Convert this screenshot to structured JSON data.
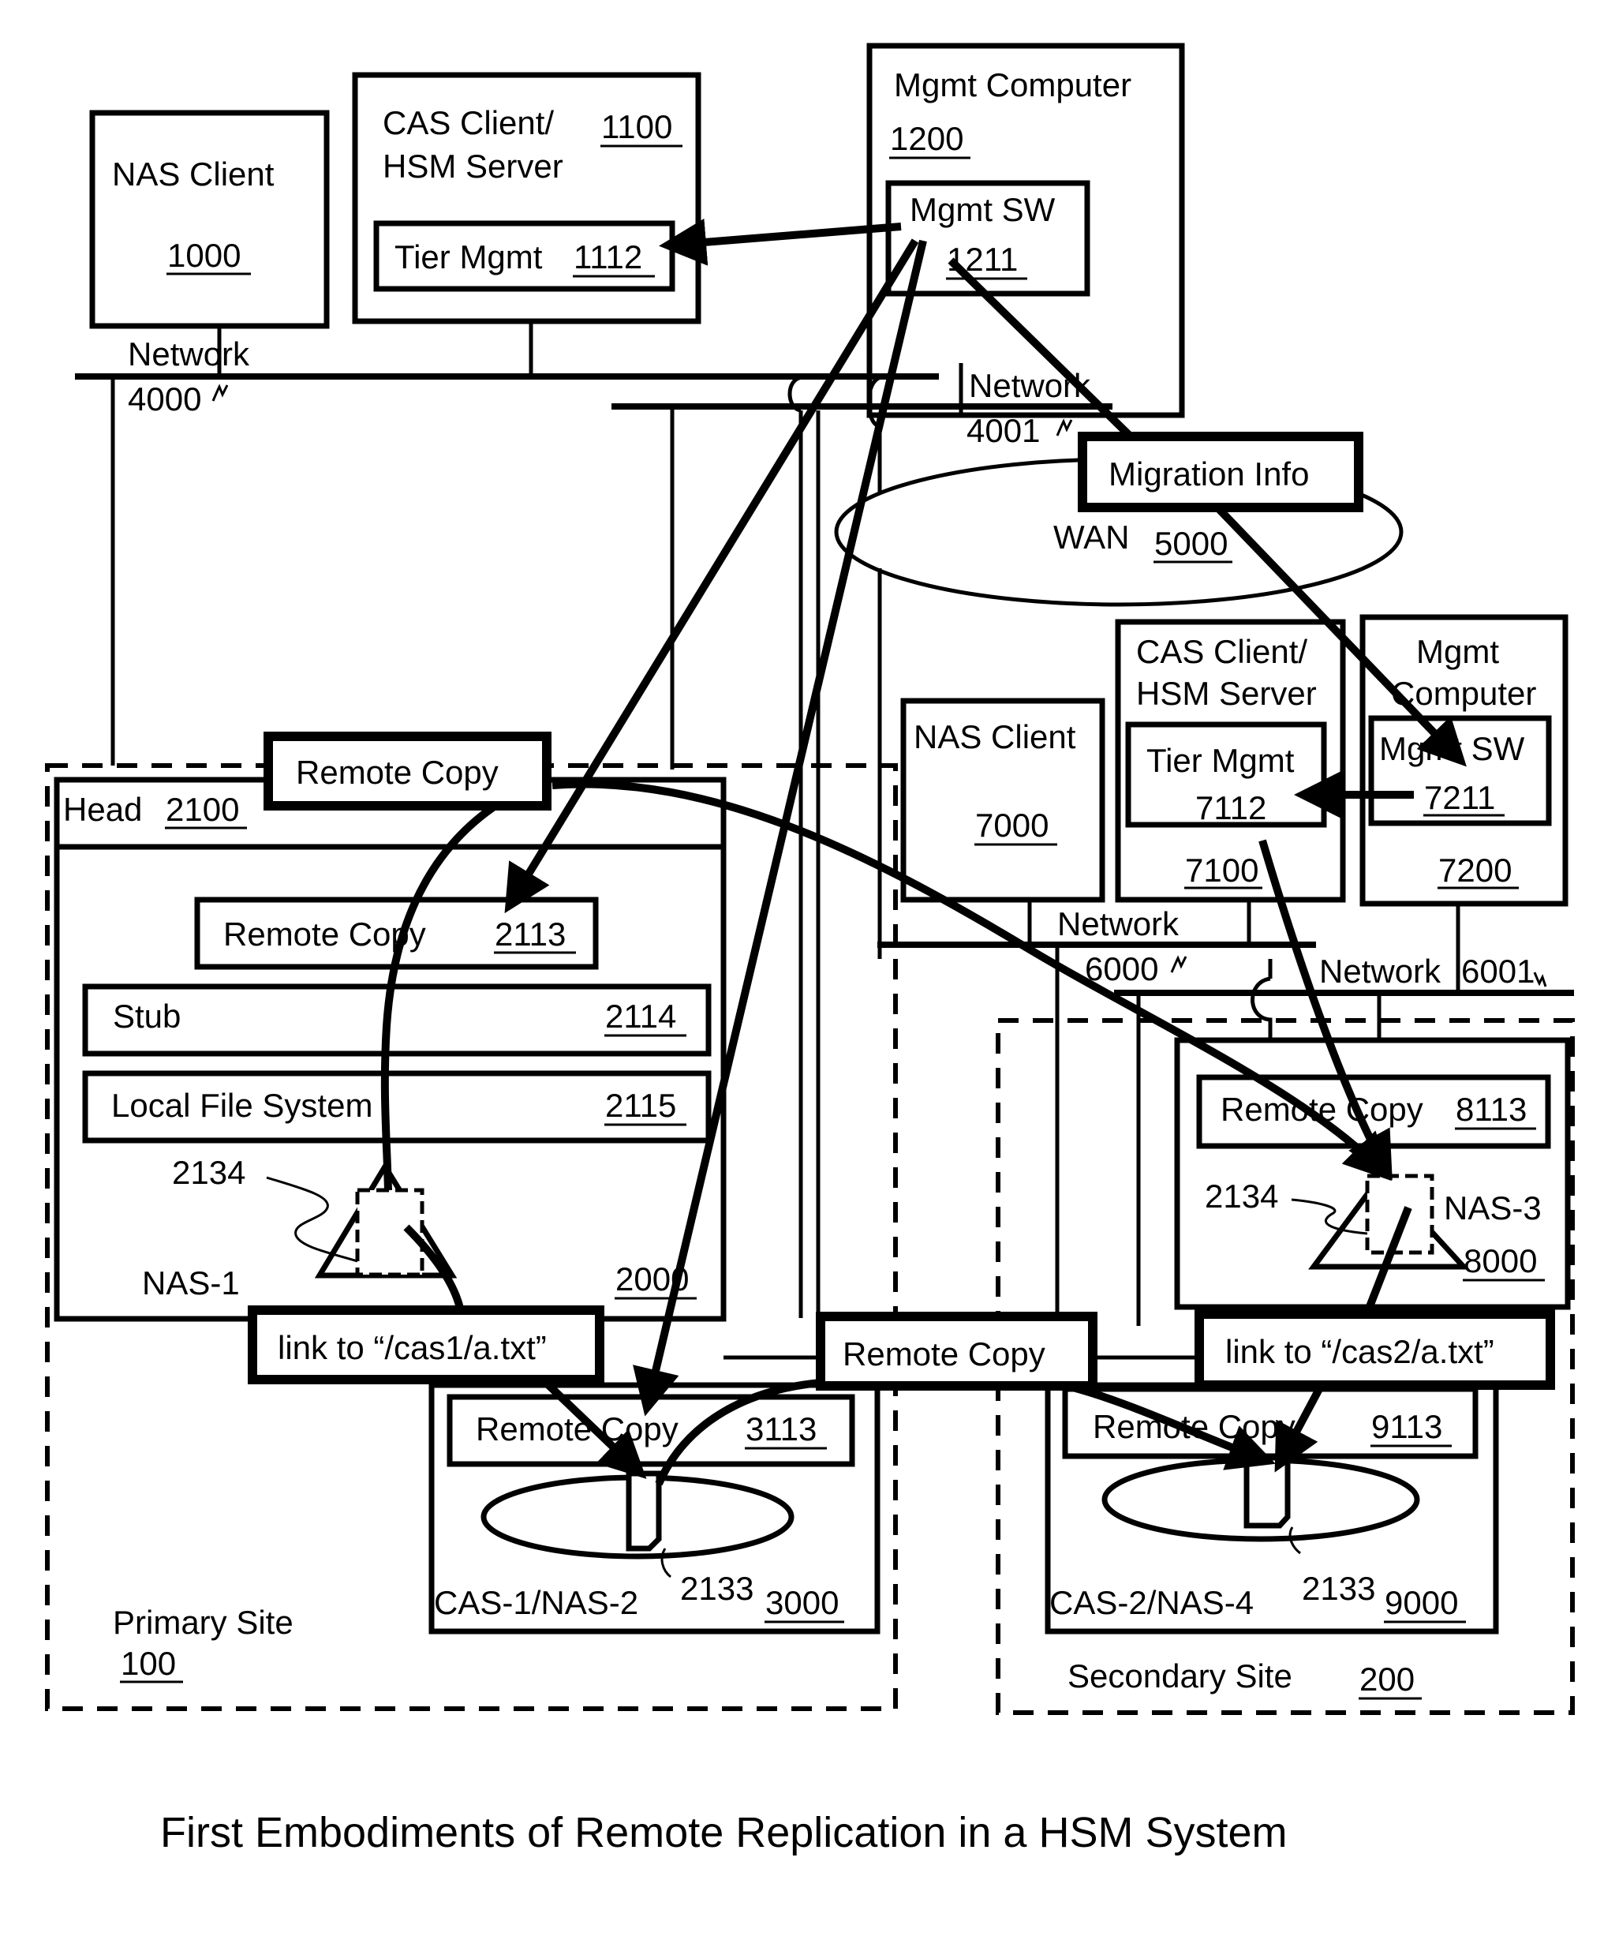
{
  "figure": {
    "caption": "First Embodiments of Remote Replication in a HSM System"
  },
  "primary_site": {
    "label": "Primary Site",
    "ref": "100",
    "nas_client": {
      "label": "NAS Client",
      "ref": "1000"
    },
    "cas_client": {
      "label_line1": "CAS Client/",
      "label_line2": "HSM Server",
      "ref": "1100",
      "tier_mgmt": {
        "label": "Tier Mgmt",
        "ref": "1112"
      }
    },
    "mgmt_computer": {
      "label": "Mgmt Computer",
      "ref": "1200",
      "mgmt_sw": {
        "label": "Mgmt SW",
        "ref": "1211"
      }
    },
    "network_a": {
      "label": "Network",
      "ref": "4000"
    },
    "network_b": {
      "label": "Network",
      "ref": "4001"
    },
    "nas1": {
      "head": {
        "label": "Head",
        "ref": "2100"
      },
      "remote_copy": {
        "label": "Remote Copy",
        "ref": "2113"
      },
      "stub": {
        "label": "Stub",
        "ref": "2114"
      },
      "local_fs": {
        "label": "Local File System",
        "ref": "2115"
      },
      "stub_ref": "2134",
      "name": "NAS-1",
      "ref": "2000"
    },
    "cas1": {
      "remote_copy": {
        "label": "Remote Copy",
        "ref": "3113"
      },
      "file_ref": "2133",
      "name": "CAS-1/NAS-2",
      "ref": "3000"
    },
    "link_callout": "link to “/cas1/a.txt”",
    "remote_copy_callout": "Remote Copy"
  },
  "wan": {
    "label": "WAN",
    "ref": "5000"
  },
  "migration_info": "Migration Info",
  "middle_remote_copy_callout": "Remote Copy",
  "secondary_site": {
    "label": "Secondary Site",
    "ref": "200",
    "nas_client": {
      "label": "NAS Client",
      "ref": "7000"
    },
    "cas_client": {
      "label_line1": "CAS Client/",
      "label_line2": "HSM Server",
      "ref": "7100",
      "tier_mgmt": {
        "label": "Tier Mgmt",
        "ref": "7112"
      }
    },
    "mgmt_computer": {
      "label_line1": "Mgmt",
      "label_line2": "Computer",
      "ref": "7200",
      "mgmt_sw": {
        "label": "Mgmt SW",
        "ref": "7211"
      }
    },
    "network_a": {
      "label": "Network",
      "ref": "6000"
    },
    "network_b": {
      "label": "Network",
      "ref": "6001"
    },
    "nas3": {
      "remote_copy": {
        "label": "Remote Copy",
        "ref": "8113"
      },
      "stub_ref": "2134",
      "name": "NAS-3",
      "ref": "8000"
    },
    "cas2": {
      "remote_copy": {
        "label": "Remote Copy",
        "ref": "9113"
      },
      "file_ref": "2133",
      "name": "CAS-2/NAS-4",
      "ref": "9000"
    },
    "link_callout": "link to “/cas2/a.txt”"
  }
}
